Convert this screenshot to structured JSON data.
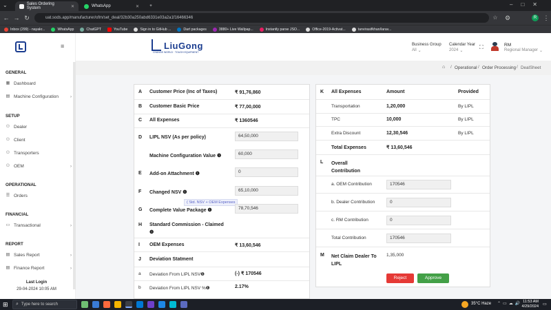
{
  "browser": {
    "tabs": [
      {
        "title": "Sales Ordering System"
      },
      {
        "title": "WhatsApp"
      }
    ],
    "new_tab": "+",
    "url": "uat.sods.app/manufacturer/ofm/set_deal/32b30a250abd6331e03a2a1f16466346",
    "bookmarks": [
      "Inbox (299) - nayakr...",
      "WhatsApp",
      "ChatGPT",
      "YouTube",
      "Sign in to GitHub ...",
      "Dart packages",
      "3880+ Live Wallpap...",
      "Instantly parse JSO...",
      "Office-2019-Activat...",
      "tanvirasifkhan/larav..."
    ],
    "profile_initial": "R"
  },
  "sidebar": {
    "sections": [
      {
        "title": "GENERAL",
        "items": [
          {
            "label": "Dashboard",
            "icon": "dashboard-icon"
          },
          {
            "label": "Machine Configuration",
            "icon": "machine-icon",
            "chevron": true
          }
        ]
      },
      {
        "title": "SETUP",
        "items": [
          {
            "label": "Dealer",
            "icon": "dealer-icon"
          },
          {
            "label": "Client",
            "icon": "client-icon"
          },
          {
            "label": "Transporters",
            "icon": "transporter-icon"
          },
          {
            "label": "OEM",
            "icon": "oem-icon",
            "chevron": true
          }
        ]
      },
      {
        "title": "OPERATIONAL",
        "items": [
          {
            "label": "Orders",
            "icon": "orders-icon"
          }
        ]
      },
      {
        "title": "FINANCIAL",
        "items": [
          {
            "label": "Transactional",
            "icon": "transactional-icon",
            "chevron": true
          }
        ]
      },
      {
        "title": "REPORT",
        "items": [
          {
            "label": "Sales Report",
            "icon": "sales-report-icon",
            "chevron": true
          },
          {
            "label": "Finance Report",
            "icon": "finance-report-icon",
            "chevron": true
          }
        ]
      }
    ],
    "last_login_label": "Last Login",
    "last_login_value": "29-04-2024 10:05 AM"
  },
  "header": {
    "logo_text": "LiuGong",
    "logo_tagline": "CHANGE WORLD · TOUGH EQUIPMENT",
    "business_group_label": "Business Group",
    "business_group_value": "All",
    "calendar_year_label": "Calendar Year",
    "calendar_year_value": "2024",
    "user_name": "RM",
    "user_role": "Regional Manager"
  },
  "breadcrumb": [
    "Operational",
    "Order Processing",
    "DealSheet"
  ],
  "left_card": {
    "rows": [
      {
        "key": "A",
        "label": "Customer Price (Inc of Taxes)",
        "value": "₹ 91,76,860"
      },
      {
        "key": "B",
        "label": "Customer Basic Price",
        "value": "₹ 77,00,000"
      },
      {
        "key": "C",
        "label": "All Expenses",
        "value": "₹ 1360546"
      },
      {
        "key": "D",
        "label": "LIPL NSV (As per policy)",
        "input": "64,50,000"
      },
      {
        "key": "",
        "label": "Machine Configuration Value ❶",
        "input": "60,000"
      },
      {
        "key": "E",
        "label": "Add-on Attachment ❶",
        "input": "0"
      },
      {
        "key": "F",
        "label": "Changed NSV ❶",
        "input": "65,10,000"
      },
      {
        "key": "G",
        "label": "Complete Value Package ❶",
        "input": "78,70,546"
      },
      {
        "key": "H",
        "label": "Standard Commission - Claimed",
        "info": "❶"
      },
      {
        "key": "I",
        "label": "OEM Expenses",
        "value": "₹ 13,60,546"
      },
      {
        "key": "J",
        "label": "Deviation Statment"
      },
      {
        "key": "a",
        "label": "Deviation From LIPL NSV❶",
        "value": "(-) ₹ 170546"
      },
      {
        "key": "b",
        "label": "Deviation From LIPL NSV %❶",
        "value": "2.17%"
      }
    ],
    "tooltip": "( Std. NSV + OEM Expenses"
  },
  "right_card": {
    "header": {
      "key": "K",
      "label": "All Expenses",
      "amount": "Amount",
      "provided": "Provided"
    },
    "expenses": [
      {
        "label": "Transportation",
        "amount": "1,20,000",
        "provided": "By LIPL"
      },
      {
        "label": "TPC",
        "amount": "10,000",
        "provided": "By LIPL"
      },
      {
        "label": "Extra Discount",
        "amount": "12,30,546",
        "provided": "By LIPL"
      }
    ],
    "total_label": "Total Expenses",
    "total_value": "₹ 13,60,546",
    "contrib_key": "L",
    "contrib_title": "Overall Contribution",
    "contributions": [
      {
        "label": "a.  OEM Contribution",
        "value": "170546"
      },
      {
        "label": "b.  Dealer Contribution",
        "value": "0"
      },
      {
        "label": "c.  RM Contribution",
        "value": "0"
      },
      {
        "label": "Total Contribution",
        "value": "170546"
      }
    ],
    "net_key": "M",
    "net_label": "Net Claim Dealer To LIPL",
    "net_value": "1,35,000",
    "reject_label": "Reject",
    "approve_label": "Approve"
  },
  "taskbar": {
    "search_placeholder": "Type here to search",
    "weather": "35°C  Haze",
    "time": "11:53 AM",
    "date": "4/29/2024"
  },
  "colors": {
    "reject": "#e53935",
    "approve": "#43a047",
    "brand": "#1a3c8f"
  }
}
